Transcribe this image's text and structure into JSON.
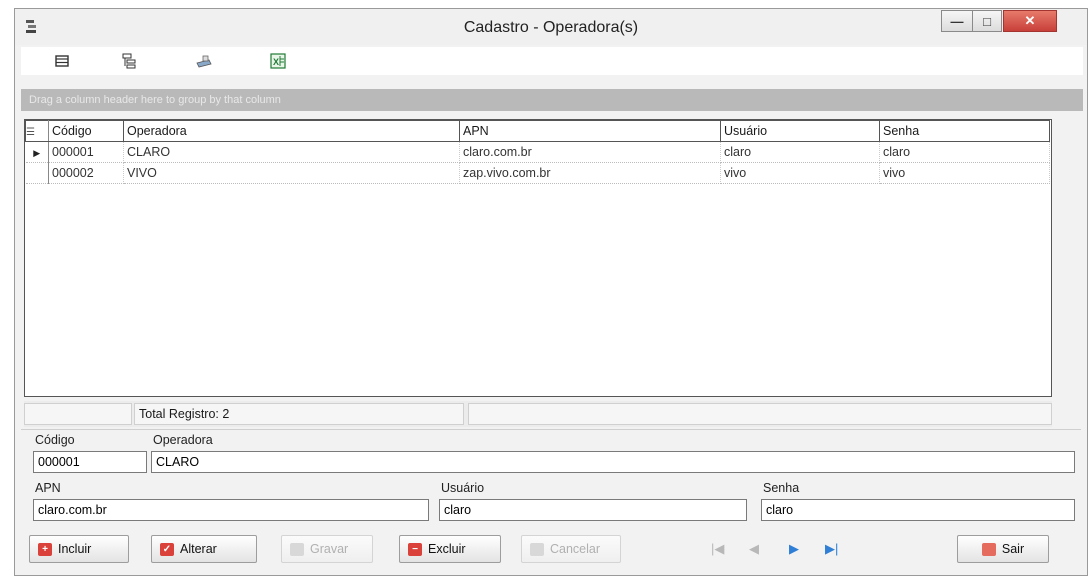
{
  "window": {
    "title": "Cadastro - Operadora(s)"
  },
  "toolbar": {
    "icons": [
      "layout-icon",
      "tree-icon",
      "print-icon",
      "excel-icon"
    ]
  },
  "grid": {
    "group_hint": "Drag a column header here to group by that column",
    "columns": [
      "Código",
      "Operadora",
      "APN",
      "Usuário",
      "Senha"
    ],
    "rows": [
      [
        "000001",
        "CLARO",
        "claro.com.br",
        "claro",
        "claro"
      ],
      [
        "000002",
        "VIVO",
        "zap.vivo.com.br",
        "vivo",
        "vivo"
      ]
    ],
    "selected_row": 0,
    "total_label": "Total Registro: 2"
  },
  "form": {
    "codigo_label": "Código",
    "codigo_value": "000001",
    "operadora_label": "Operadora",
    "operadora_value": "CLARO",
    "apn_label": "APN",
    "apn_value": "claro.com.br",
    "usuario_label": "Usuário",
    "usuario_value": "claro",
    "senha_label": "Senha",
    "senha_value": "claro"
  },
  "buttons": {
    "incluir": "Incluir",
    "alterar": "Alterar",
    "gravar": "Gravar",
    "excluir": "Excluir",
    "cancelar": "Cancelar",
    "sair": "Sair"
  },
  "colors": {
    "accent_red": "#d9413a",
    "close_red": "#c8403a",
    "nav_blue": "#2f7fd6"
  }
}
